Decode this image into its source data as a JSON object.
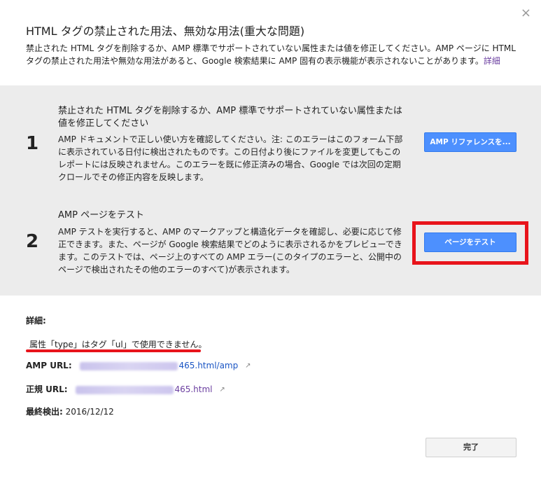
{
  "dialog": {
    "title": "HTML タグの禁止された用法、無効な用法(重大な問題)",
    "description": "禁止された HTML タグを削除するか、AMP 標準でサポートされていない属性または値を修正してください。AMP ページに HTML タグの禁止された用法や無効な用法があると、Google 検索結果に AMP 固有の表示機能が表示されないことがあります。",
    "details_link": "詳細",
    "close_label": "×"
  },
  "steps": [
    {
      "number": "1",
      "title": "禁止された HTML タグを削除するか、AMP 標準でサポートされていない属性または 値を修正してください",
      "body": "AMP ドキュメントで正しい使い方を確認してください。注: このエラーはこのフォーム下部に表示されている日付に検出されたものです。この日付より後にファイルを変更してもこのレポートには反映されません。このエラーを既に修正済みの場合、Google では次回の定期クロールでその修正内容を反映します。",
      "button_label": "AMP リファレンスを..."
    },
    {
      "number": "2",
      "title": "AMP ページをテスト",
      "body": "AMP テストを実行すると、AMP のマークアップと構造化データを確認し、必要に応じて修正できます。また、ページが Google 検索結果でどのように表示されるかをプレビューできます。このテストでは、ページ上のすべての AMP エラー(このタイプのエラーと、公開中のページで検出されたその他のエラーのすべて)が表示されます。",
      "button_label": "ページをテスト"
    }
  ],
  "details": {
    "heading": "詳細:",
    "error_message": "属性「type」はタグ「ul」で使用できません。",
    "amp_url_label": "AMP URL:",
    "amp_url_suffix": "465.html/amp",
    "canonical_url_label": "正規 URL:",
    "canonical_url_suffix": "465.html",
    "last_detected_label": "最終検出:",
    "last_detected_value": "2016/12/12"
  },
  "footer": {
    "done_label": "完了"
  },
  "colors": {
    "accent_blue": "#4d90fe",
    "highlight_red": "#e8141b",
    "link_blue": "#1a55c4",
    "link_purple": "#6b3fa0",
    "band_gray": "#ececec"
  }
}
